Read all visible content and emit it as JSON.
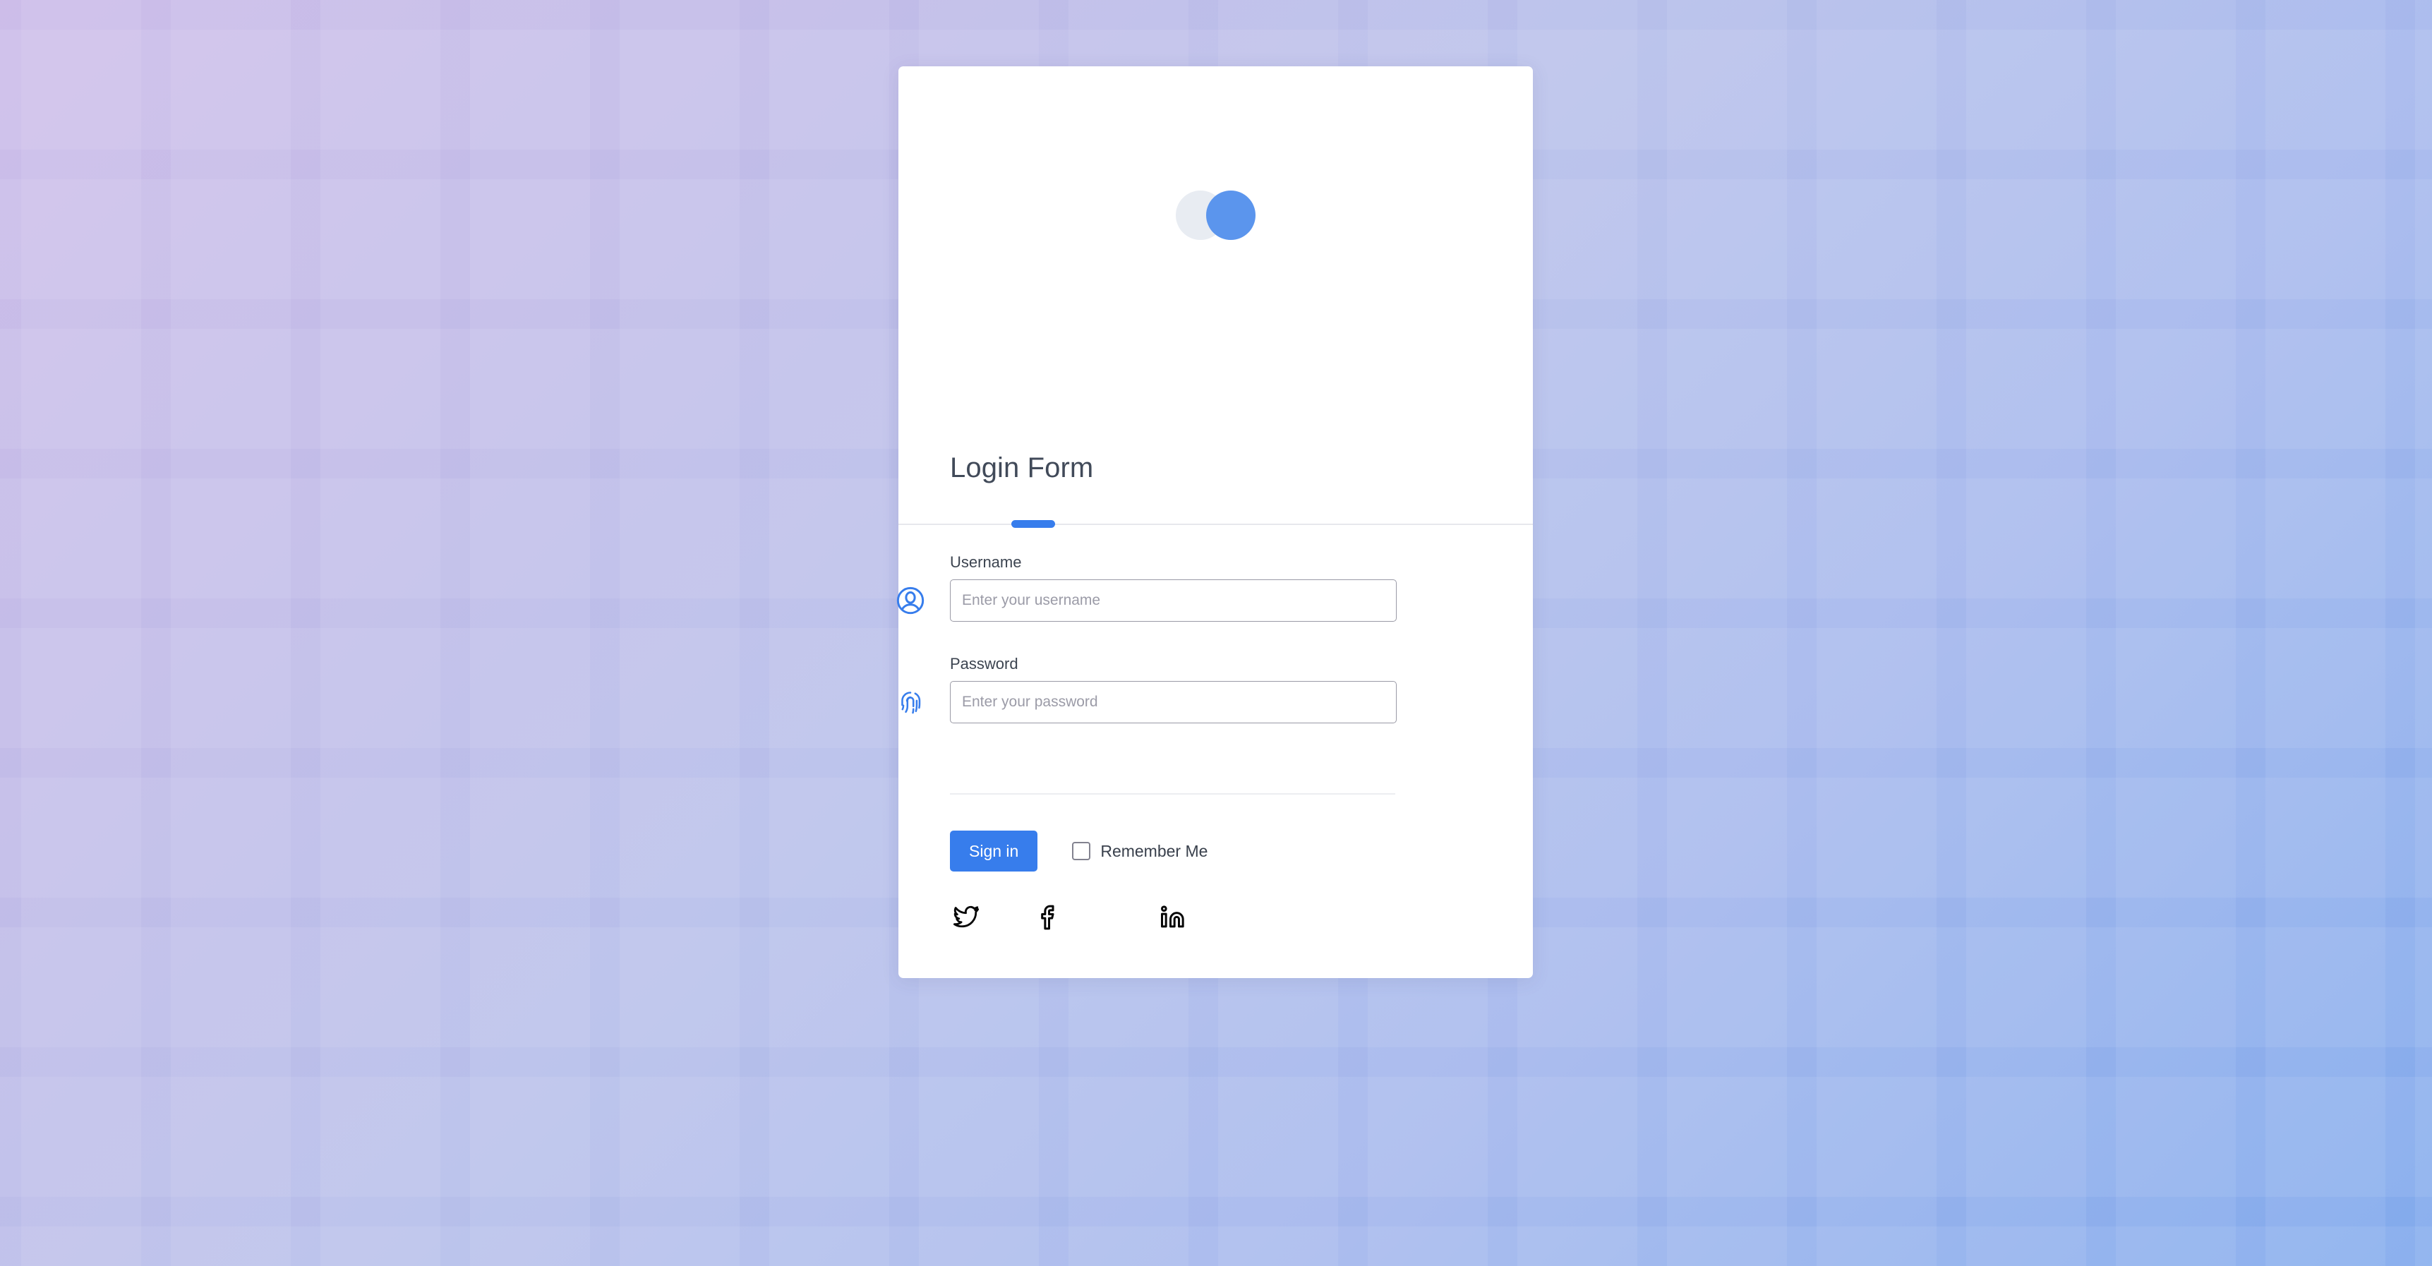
{
  "background": {
    "gradient_from": "#cdbde9",
    "gradient_to": "#82aaec",
    "pattern": "grid-tiles"
  },
  "card": {
    "brand": {
      "logo_back_icon": "circle-light",
      "logo_front_icon": "circle-blue",
      "logo_back_color": "#e8ecf2",
      "logo_front_color": "#5b95ed"
    },
    "title": "Login Form",
    "title_color": "#414a59",
    "tab_indicator_color": "#377dec",
    "form": {
      "username": {
        "label": "Username",
        "placeholder": "Enter your username",
        "value": "",
        "icon": "user-circle-icon",
        "icon_color": "#377dec"
      },
      "password": {
        "label": "Password",
        "placeholder": "Enter your password",
        "value": "",
        "icon": "fingerprint-icon",
        "icon_color": "#377dec"
      },
      "submit_label": "Sign in",
      "submit_color": "#377dec",
      "remember_label": "Remember Me",
      "remember_checked": false
    },
    "social": [
      {
        "name": "twitter",
        "icon": "twitter-icon",
        "color": "#000000"
      },
      {
        "name": "facebook",
        "icon": "facebook-icon",
        "color": "#000000"
      },
      {
        "name": "linkedin",
        "icon": "linkedin-icon",
        "color": "#000000"
      }
    ]
  }
}
